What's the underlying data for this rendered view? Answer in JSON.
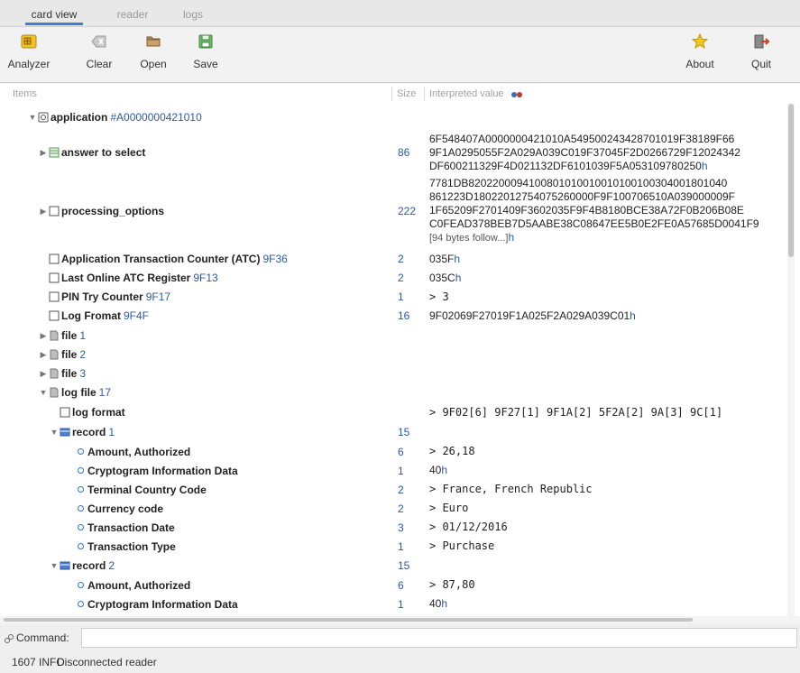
{
  "tabs": [
    {
      "label": "card view",
      "active": true
    },
    {
      "label": "reader",
      "active": false
    },
    {
      "label": "logs",
      "active": false
    }
  ],
  "toolbar": {
    "analyzer": "Analyzer",
    "clear": "Clear",
    "open": "Open",
    "save": "Save",
    "about": "About",
    "quit": "Quit"
  },
  "columns": {
    "items": "Items",
    "size": "Size",
    "value": "Interpreted value"
  },
  "rows": {
    "application": {
      "label": "application",
      "tag": "#A0000000421010"
    },
    "answer": {
      "label": "answer to select",
      "size": "86",
      "lines": [
        "6F548407A0000000421010A549500243428701019F38189F66",
        "9F1A0295055F2A029A039C019F37045F2D0266729F12024342",
        "DF600211329F4D021132DF6101039F5A053109780250"
      ],
      "suffix": "h"
    },
    "processing": {
      "label": "processing_options",
      "size": "222",
      "lines": [
        "7781DB8202200094100801010010010100100304001801040",
        "861223D18022012754075260000F9F100706510A039000009F",
        "1F65209F2701409F3602035F9F4B8180BCE38A72F0B206B08E",
        "C0FEAD378BEB7D5AABE38C08647EE5B0E2FE0A57685D0041F9"
      ],
      "more": "[94 bytes follow...]",
      "suffix": "h"
    },
    "atc": {
      "label": "Application Transaction Counter (ATC)",
      "tag": "9F36",
      "size": "2",
      "value": "035F",
      "suffix": "h"
    },
    "lastatc": {
      "label": "Last Online ATC Register",
      "tag": "9F13",
      "size": "2",
      "value": "035C",
      "suffix": "h"
    },
    "pin": {
      "label": "PIN Try Counter",
      "tag": "9F17",
      "size": "1",
      "value": "> 3"
    },
    "logformat": {
      "label": "Log Fromat",
      "tag": "9F4F",
      "size": "16",
      "value": "9F02069F27019F1A025F2A029A039C01",
      "suffix": "h"
    },
    "file1": {
      "label": "file",
      "tag": "1"
    },
    "file2": {
      "label": "file",
      "tag": "2"
    },
    "file3": {
      "label": "file",
      "tag": "3"
    },
    "logfile": {
      "label": "log file",
      "tag": "17"
    },
    "logfmt": {
      "label": "log format",
      "value": "> 9F02[6] 9F27[1] 9F1A[2] 5F2A[2] 9A[3] 9C[1]"
    },
    "record1": {
      "label": "record",
      "tag": "1",
      "size": "15"
    },
    "r1amount": {
      "label": "Amount, Authorized",
      "size": "6",
      "value": "> 26,18"
    },
    "r1crypto": {
      "label": "Cryptogram Information Data",
      "size": "1",
      "value": "40",
      "suffix": "h"
    },
    "r1country": {
      "label": "Terminal Country Code",
      "size": "2",
      "value": "> France, French Republic"
    },
    "r1currency": {
      "label": "Currency code",
      "size": "2",
      "value": "> Euro"
    },
    "r1date": {
      "label": "Transaction Date",
      "size": "3",
      "value": "> 01/12/2016"
    },
    "r1type": {
      "label": "Transaction Type",
      "size": "1",
      "value": "> Purchase"
    },
    "record2": {
      "label": "record",
      "tag": "2",
      "size": "15"
    },
    "r2amount": {
      "label": "Amount, Authorized",
      "size": "6",
      "value": "> 87,80"
    },
    "r2crypto": {
      "label": "Cryptogram Information Data",
      "size": "1",
      "value": "40",
      "suffix": "h"
    }
  },
  "command": {
    "label": "Command:",
    "value": ""
  },
  "status": {
    "code": "1607 INFO",
    "message": "Disconnected reader"
  },
  "colors": {
    "accent": "#3b7fd1",
    "tag": "#2d5aa0",
    "bullet": "#2d74c9"
  }
}
